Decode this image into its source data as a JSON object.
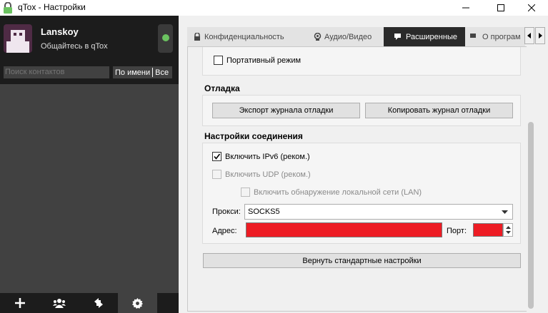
{
  "window": {
    "title": "qTox - Настройки"
  },
  "profile": {
    "username": "Lanskoy",
    "status_message": "Общайтесь в qTox",
    "status_color": "#6bc260"
  },
  "contacts": {
    "search_placeholder": "Поиск контактов",
    "sort_by": "По имени",
    "filter": "Все"
  },
  "bottom_bar": {
    "icons": [
      "add-icon",
      "group-icon",
      "transfer-icon",
      "settings-icon"
    ],
    "active": "settings-icon"
  },
  "tabs": [
    {
      "label": "Конфиденциальность",
      "icon": "lock-icon"
    },
    {
      "label": "Аудио/Видео",
      "icon": "webcam-icon"
    },
    {
      "label": "Расширенные",
      "icon": "advanced-icon",
      "active": true
    },
    {
      "label": "О програм",
      "icon": "info-icon"
    }
  ],
  "portable": {
    "label": "Портативный режим",
    "checked": false
  },
  "debug": {
    "title": "Отладка",
    "export_button": "Экспорт журнала отладки",
    "copy_button": "Копировать журнал отладки"
  },
  "connection": {
    "title": "Настройки соединения",
    "ipv6_label": "Включить IPv6 (реком.)",
    "ipv6_checked": true,
    "udp_label": "Включить UDP (реком.)",
    "lan_label": "Включить обнаружение локальной сети (LAN)",
    "proxy_label": "Прокси:",
    "proxy_value": "SOCKS5",
    "address_label": "Адрес:",
    "port_label": "Порт:",
    "redacted_color": "#ed1c24"
  },
  "reset_button": "Вернуть стандартные настройки"
}
